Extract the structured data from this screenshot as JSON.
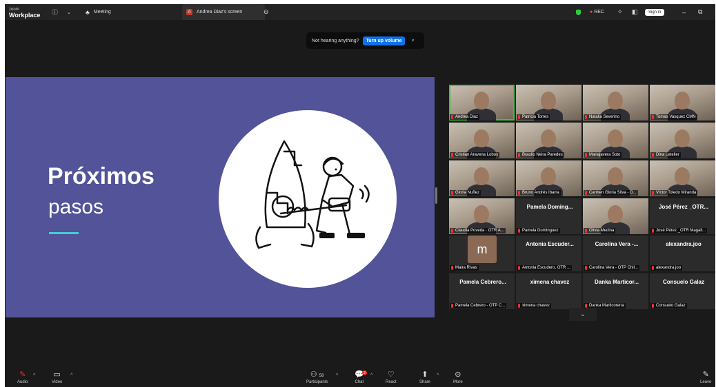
{
  "titlebar": {
    "app_line1": "zoom",
    "app_line2": "Workplace",
    "info_icon": "info-icon",
    "meeting_label": "Meeting",
    "tab_avatar": "A",
    "tab_label": "Andrea Diaz's screen",
    "rec_label": "REC",
    "signin_label": "Sign in"
  },
  "notice": {
    "text": "Not hearing anything?",
    "button": "Turn up volume",
    "close": "×"
  },
  "slide": {
    "title": "Próximos",
    "subtitle": "pasos"
  },
  "gallery": {
    "tiles": [
      {
        "label": "Andrea Diaz",
        "video": true
      },
      {
        "label": "Patricia Torres",
        "video": true
      },
      {
        "label": "Natalia Severino",
        "video": true
      },
      {
        "label": "Tomas Vasquez CMN",
        "video": true
      },
      {
        "label": "Cristian Aravena Lobos",
        "video": true
      },
      {
        "label": "Braulio Neira Paredes",
        "video": true
      },
      {
        "label": "Mariajavera Soto",
        "video": true
      },
      {
        "label": "Dina Letelier",
        "video": true
      },
      {
        "label": "Gloria Nuñez",
        "video": true
      },
      {
        "label": "Bruno Andrés Ibarra",
        "video": true
      },
      {
        "label": "Carmen Gloria Silva - O...",
        "video": true
      },
      {
        "label": "Víctor Toledo Miranda",
        "video": true
      },
      {
        "label": "Claudia Poveda · OTR A...",
        "video": true
      },
      {
        "name": "Pamela Doming...",
        "label": "Pamela Domínguez",
        "video": false
      },
      {
        "label": "Olivia Medina",
        "video": true
      },
      {
        "name": "José Pérez _OTR...",
        "label": "José Pérez _OTR Magall...",
        "video": false
      },
      {
        "avatar": "m",
        "label": "Maira Rivas",
        "video": false
      },
      {
        "name": "Antonia Escuder...",
        "label": "Antonia Escudero, OTR ...",
        "video": false
      },
      {
        "name": "Carolina Vera -...",
        "label": "Carolina Vera - OTP Chil...",
        "video": false
      },
      {
        "name": "alexandra.joo",
        "label": "alexandra.joo",
        "video": false
      },
      {
        "name": "Pamela Cebrero...",
        "label": "Pamela Cebrero - OTP C...",
        "video": false
      },
      {
        "name": "ximena chavez",
        "label": "ximena chavez",
        "video": false
      },
      {
        "name": "Danka Marticor...",
        "label": "Danka Marticorena",
        "video": false
      },
      {
        "name": "Consuelo Galaz",
        "label": "Consuelo Galaz",
        "video": false
      }
    ],
    "expand_icon": "chevron-down-icon"
  },
  "toolbar": {
    "audio": "Audio",
    "video": "Video",
    "participants": "Participants",
    "participants_count": "58",
    "chat": "Chat",
    "chat_badge": "2",
    "react": "React",
    "share": "Share",
    "more": "More",
    "leave": "Leave"
  }
}
